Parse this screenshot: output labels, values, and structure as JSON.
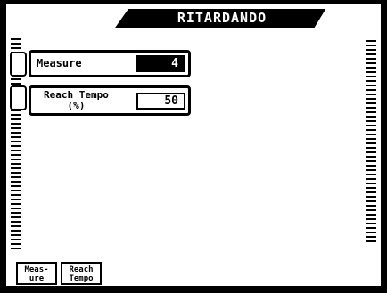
{
  "window": {
    "title": "RITARDANDO"
  },
  "fields": {
    "measure": {
      "label": "Measure",
      "value": "4"
    },
    "reach_tempo": {
      "label_line1": "Reach Tempo",
      "label_line2": "(%)",
      "value": "50"
    }
  },
  "tabs": [
    {
      "line1": "Meas-",
      "line2": "ure"
    },
    {
      "line1": "Reach",
      "line2": "Tempo"
    }
  ],
  "colors": {
    "background": "#ffffff",
    "foreground": "#000000"
  }
}
